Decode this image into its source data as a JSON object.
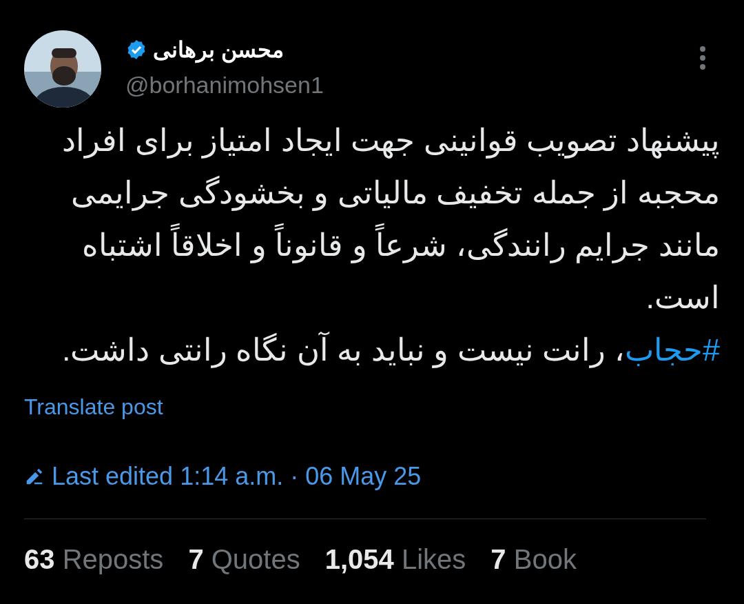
{
  "author": {
    "name": "محسن برهانی",
    "handle": "@borhanimohsen1",
    "verified": true
  },
  "post": {
    "lines": [
      "پیشنهاد تصویب قوانینی جهت ایجاد امتیاز برای افراد",
      "محجبه از جمله تخفیف مالیاتی و بخشودگی جرایمی",
      "مانند جرایم رانندگی، شرعاً و قانوناً و اخلاقاً اشتباه",
      "است."
    ],
    "hashtag": "#حجاب",
    "after_hashtag": "، رانت نیست و نباید به آن نگاه رانتی داشت."
  },
  "translate": "Translate post",
  "edited": "Last edited 1:14 a.m. · 06 May 25",
  "stats": {
    "reposts": {
      "count": "63",
      "label": "Reposts"
    },
    "quotes": {
      "count": "7",
      "label": "Quotes"
    },
    "likes": {
      "count": "1,054",
      "label": "Likes"
    },
    "bookmarks": {
      "count": "7",
      "label": "Book"
    }
  }
}
